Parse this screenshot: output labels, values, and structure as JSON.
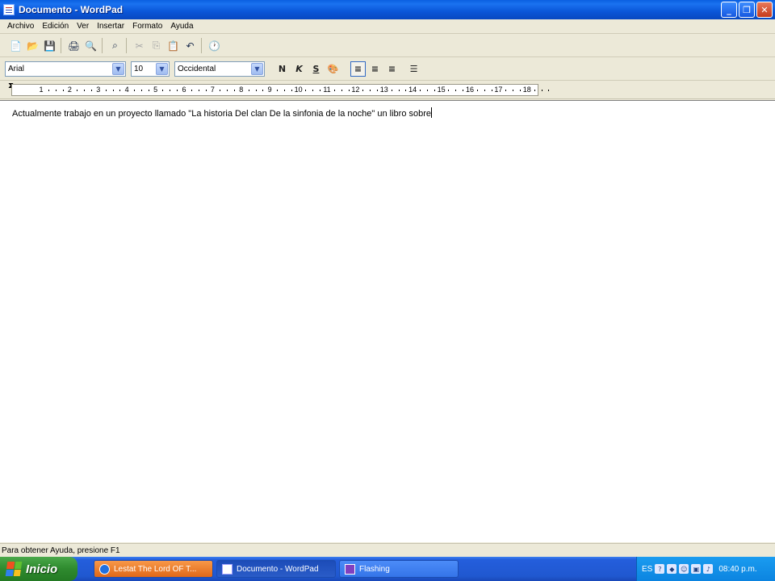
{
  "window": {
    "title": "Documento - WordPad",
    "minimize_glyph": "_",
    "maximize_glyph": "❐",
    "close_glyph": "✕"
  },
  "menu": {
    "items": [
      "Archivo",
      "Edición",
      "Ver",
      "Insertar",
      "Formato",
      "Ayuda"
    ]
  },
  "toolbar": {
    "icons": {
      "new": "📄",
      "open": "📂",
      "save": "💾",
      "print": "🖨",
      "preview": "🔍",
      "find": "⌕",
      "cut": "✂",
      "copy": "⎘",
      "paste": "📋",
      "undo": "↶",
      "datetime": "🕐"
    }
  },
  "format": {
    "font": "Arial",
    "size": "10",
    "script": "Occidental",
    "bold": "N",
    "italic": "K",
    "underline": "S",
    "color": "🎨",
    "align_left": "≡",
    "align_center": "≡",
    "align_right": "≡",
    "bullets": "☰"
  },
  "ruler": {
    "labels": [
      "1",
      "2",
      "3",
      "4",
      "5",
      "6",
      "7",
      "8",
      "9",
      "10",
      "11",
      "12",
      "13",
      "14",
      "15",
      "16",
      "17",
      "18"
    ]
  },
  "document": {
    "text": "Actualmente trabajo en un proyecto llamado \"La historia Del clan De la sinfonia de la noche\" un libro sobre"
  },
  "status": {
    "text": "Para obtener Ayuda, presione F1"
  },
  "taskbar": {
    "start_label": "Inicio",
    "tasks": [
      {
        "label": "Lestat The Lord OF T..."
      },
      {
        "label": "Documento - WordPad"
      },
      {
        "label": "Flashing"
      }
    ],
    "language": "ES",
    "clock": "08:40 p.m."
  }
}
